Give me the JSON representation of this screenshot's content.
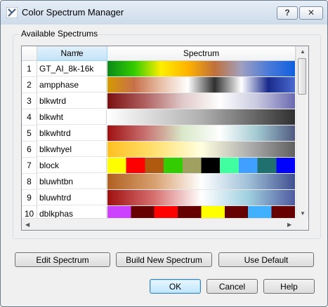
{
  "window": {
    "title": "Color Spectrum Manager",
    "help_label": "?",
    "close_label": "✕"
  },
  "group": {
    "label": "Available Spectrums"
  },
  "table": {
    "headers": {
      "name": "Name",
      "spectrum": "Spectrum"
    },
    "rows": [
      {
        "num": "1",
        "name": "GT_AI_8k-16k",
        "colors": [
          "#0a8a1a",
          "#33cc00",
          "#ffee00",
          "#ffb300",
          "#c0703a",
          "#a0a0c0",
          "#4a7ad8",
          "#1060e0"
        ]
      },
      {
        "num": "2",
        "name": "ampphase",
        "colors": [
          "#d49a00",
          "#c8704a",
          "#e8c0a8",
          "#ffffff",
          "#303030",
          "#ffffff",
          "#1a2a8c",
          "#4a6ad0"
        ]
      },
      {
        "num": "3",
        "name": "blkwtrd",
        "colors": [
          "#7a1010",
          "#b06060",
          "#e0c8c8",
          "#ffffff",
          "#c8c8e0",
          "#6a6ab0"
        ]
      },
      {
        "num": "4",
        "name": "blkwht",
        "colors": [
          "#ffffff",
          "#b0b0b0",
          "#303030"
        ]
      },
      {
        "num": "5",
        "name": "blkwhtrd",
        "colors": [
          "#a01010",
          "#c87070",
          "#d8e8c8",
          "#ffffff",
          "#a0c8d0",
          "#505a80"
        ]
      },
      {
        "num": "6",
        "name": "blkwhyel",
        "colors": [
          "#ffc020",
          "#ffe070",
          "#ffffe0",
          "#b0b0b0",
          "#606060"
        ]
      },
      {
        "num": "7",
        "name": "block",
        "colors": [
          "#ffff00",
          "#ff0000",
          "#b05a10",
          "#33cc00",
          "#a0a060",
          "#000000",
          "#40ffa0",
          "#40a0ff",
          "#207070",
          "#0000ff"
        ]
      },
      {
        "num": "8",
        "name": "bluwhtbn",
        "colors": [
          "#b06020",
          "#d8a070",
          "#ffffff",
          "#a0c0d8",
          "#405090"
        ]
      },
      {
        "num": "9",
        "name": "bluwhtrd",
        "colors": [
          "#a01010",
          "#d87070",
          "#ffffff",
          "#a0d0e0",
          "#505aa0"
        ]
      },
      {
        "num": "10",
        "name": "dblkphas",
        "colors": [
          "#cc40ff",
          "#660000",
          "#ff0000",
          "#660000",
          "#ffff00",
          "#660000",
          "#40b0ff",
          "#660000"
        ]
      }
    ],
    "partial_colors": [
      "#2040ff",
      "#00ff00",
      "#ffff00",
      "#ff8000",
      "#ff0000"
    ]
  },
  "buttons": {
    "edit": "Edit Spectrum",
    "build": "Build New Spectrum",
    "default": "Use Default",
    "ok": "OK",
    "cancel": "Cancel",
    "help": "Help"
  }
}
